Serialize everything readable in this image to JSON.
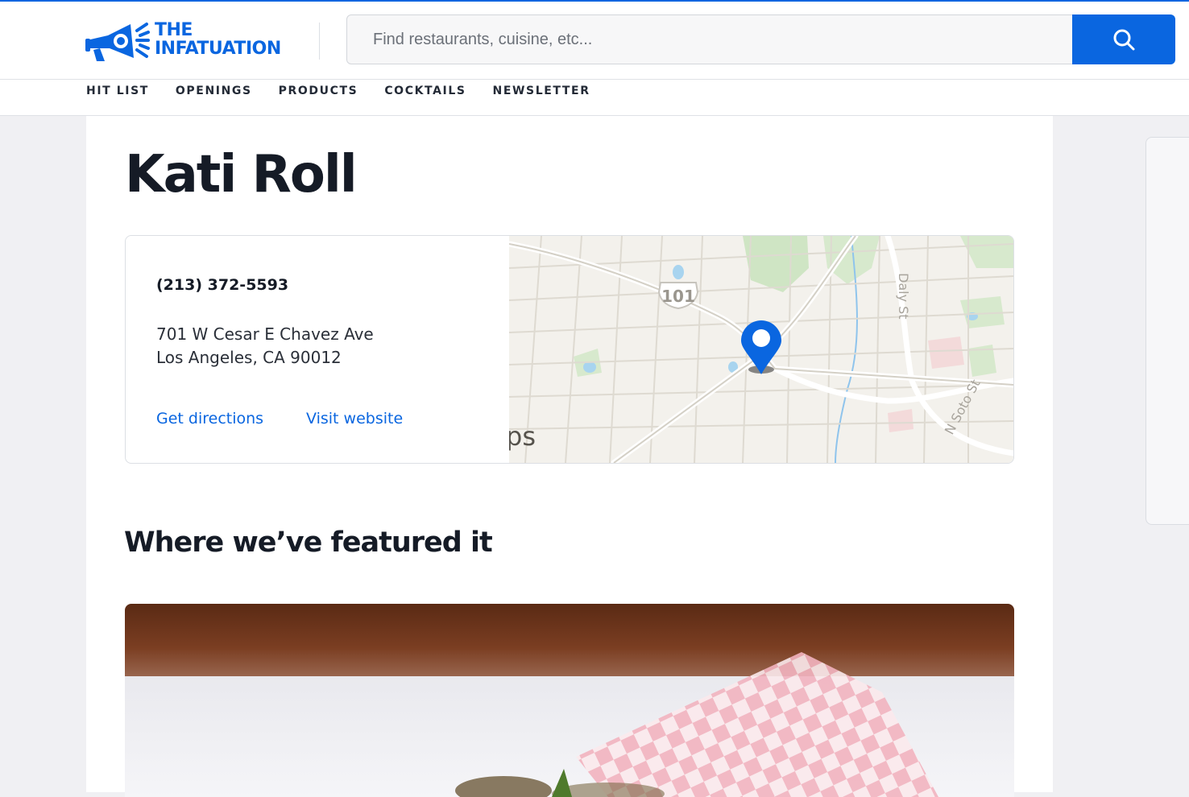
{
  "header": {
    "logo": {
      "line1": "THE",
      "line2": "INFATUATION"
    },
    "search": {
      "placeholder": "Find restaurants, cuisine, etc..."
    }
  },
  "nav": {
    "items": [
      {
        "label": "HIT LIST"
      },
      {
        "label": "OPENINGS"
      },
      {
        "label": "PRODUCTS"
      },
      {
        "label": "COCKTAILS"
      },
      {
        "label": "NEWSLETTER"
      }
    ]
  },
  "restaurant": {
    "name": "Kati Roll",
    "phone": "(213) 372-5593",
    "address_line1": "701 W Cesar E Chavez Ave",
    "address_line2": "Los Angeles, CA 90012",
    "directions_label": "Get directions",
    "website_label": "Visit website"
  },
  "map": {
    "highway_label": "101",
    "street_label_1": "Daly St",
    "street_label_2": "N Soto St",
    "attribution_fragment": "ps"
  },
  "featured": {
    "heading": "Where we’ve featured it"
  },
  "colors": {
    "accent": "#0a66e0",
    "text": "#151b26",
    "page_bg": "#f0f0f3"
  },
  "icons": [
    "megaphone-logo-icon",
    "search-icon",
    "map-pin-icon"
  ]
}
